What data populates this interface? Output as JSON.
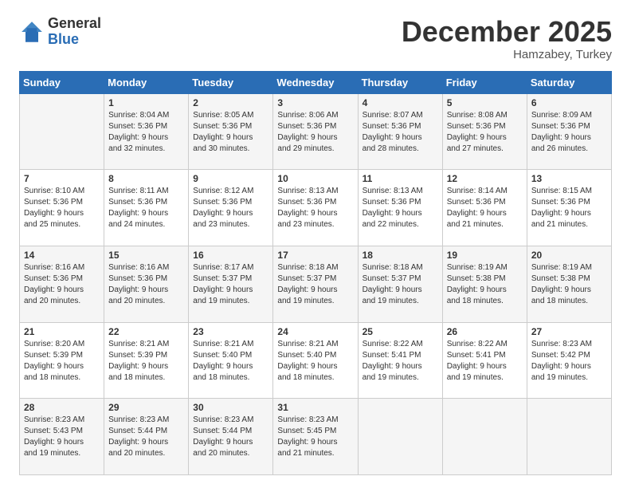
{
  "logo": {
    "general": "General",
    "blue": "Blue"
  },
  "title": "December 2025",
  "subtitle": "Hamzabey, Turkey",
  "header_days": [
    "Sunday",
    "Monday",
    "Tuesday",
    "Wednesday",
    "Thursday",
    "Friday",
    "Saturday"
  ],
  "weeks": [
    [
      {
        "day": "",
        "info": ""
      },
      {
        "day": "1",
        "info": "Sunrise: 8:04 AM\nSunset: 5:36 PM\nDaylight: 9 hours\nand 32 minutes."
      },
      {
        "day": "2",
        "info": "Sunrise: 8:05 AM\nSunset: 5:36 PM\nDaylight: 9 hours\nand 30 minutes."
      },
      {
        "day": "3",
        "info": "Sunrise: 8:06 AM\nSunset: 5:36 PM\nDaylight: 9 hours\nand 29 minutes."
      },
      {
        "day": "4",
        "info": "Sunrise: 8:07 AM\nSunset: 5:36 PM\nDaylight: 9 hours\nand 28 minutes."
      },
      {
        "day": "5",
        "info": "Sunrise: 8:08 AM\nSunset: 5:36 PM\nDaylight: 9 hours\nand 27 minutes."
      },
      {
        "day": "6",
        "info": "Sunrise: 8:09 AM\nSunset: 5:36 PM\nDaylight: 9 hours\nand 26 minutes."
      }
    ],
    [
      {
        "day": "7",
        "info": "Sunrise: 8:10 AM\nSunset: 5:36 PM\nDaylight: 9 hours\nand 25 minutes."
      },
      {
        "day": "8",
        "info": "Sunrise: 8:11 AM\nSunset: 5:36 PM\nDaylight: 9 hours\nand 24 minutes."
      },
      {
        "day": "9",
        "info": "Sunrise: 8:12 AM\nSunset: 5:36 PM\nDaylight: 9 hours\nand 23 minutes."
      },
      {
        "day": "10",
        "info": "Sunrise: 8:13 AM\nSunset: 5:36 PM\nDaylight: 9 hours\nand 23 minutes."
      },
      {
        "day": "11",
        "info": "Sunrise: 8:13 AM\nSunset: 5:36 PM\nDaylight: 9 hours\nand 22 minutes."
      },
      {
        "day": "12",
        "info": "Sunrise: 8:14 AM\nSunset: 5:36 PM\nDaylight: 9 hours\nand 21 minutes."
      },
      {
        "day": "13",
        "info": "Sunrise: 8:15 AM\nSunset: 5:36 PM\nDaylight: 9 hours\nand 21 minutes."
      }
    ],
    [
      {
        "day": "14",
        "info": "Sunrise: 8:16 AM\nSunset: 5:36 PM\nDaylight: 9 hours\nand 20 minutes."
      },
      {
        "day": "15",
        "info": "Sunrise: 8:16 AM\nSunset: 5:36 PM\nDaylight: 9 hours\nand 20 minutes."
      },
      {
        "day": "16",
        "info": "Sunrise: 8:17 AM\nSunset: 5:37 PM\nDaylight: 9 hours\nand 19 minutes."
      },
      {
        "day": "17",
        "info": "Sunrise: 8:18 AM\nSunset: 5:37 PM\nDaylight: 9 hours\nand 19 minutes."
      },
      {
        "day": "18",
        "info": "Sunrise: 8:18 AM\nSunset: 5:37 PM\nDaylight: 9 hours\nand 19 minutes."
      },
      {
        "day": "19",
        "info": "Sunrise: 8:19 AM\nSunset: 5:38 PM\nDaylight: 9 hours\nand 18 minutes."
      },
      {
        "day": "20",
        "info": "Sunrise: 8:19 AM\nSunset: 5:38 PM\nDaylight: 9 hours\nand 18 minutes."
      }
    ],
    [
      {
        "day": "21",
        "info": "Sunrise: 8:20 AM\nSunset: 5:39 PM\nDaylight: 9 hours\nand 18 minutes."
      },
      {
        "day": "22",
        "info": "Sunrise: 8:21 AM\nSunset: 5:39 PM\nDaylight: 9 hours\nand 18 minutes."
      },
      {
        "day": "23",
        "info": "Sunrise: 8:21 AM\nSunset: 5:40 PM\nDaylight: 9 hours\nand 18 minutes."
      },
      {
        "day": "24",
        "info": "Sunrise: 8:21 AM\nSunset: 5:40 PM\nDaylight: 9 hours\nand 18 minutes."
      },
      {
        "day": "25",
        "info": "Sunrise: 8:22 AM\nSunset: 5:41 PM\nDaylight: 9 hours\nand 19 minutes."
      },
      {
        "day": "26",
        "info": "Sunrise: 8:22 AM\nSunset: 5:41 PM\nDaylight: 9 hours\nand 19 minutes."
      },
      {
        "day": "27",
        "info": "Sunrise: 8:23 AM\nSunset: 5:42 PM\nDaylight: 9 hours\nand 19 minutes."
      }
    ],
    [
      {
        "day": "28",
        "info": "Sunrise: 8:23 AM\nSunset: 5:43 PM\nDaylight: 9 hours\nand 19 minutes."
      },
      {
        "day": "29",
        "info": "Sunrise: 8:23 AM\nSunset: 5:44 PM\nDaylight: 9 hours\nand 20 minutes."
      },
      {
        "day": "30",
        "info": "Sunrise: 8:23 AM\nSunset: 5:44 PM\nDaylight: 9 hours\nand 20 minutes."
      },
      {
        "day": "31",
        "info": "Sunrise: 8:23 AM\nSunset: 5:45 PM\nDaylight: 9 hours\nand 21 minutes."
      },
      {
        "day": "",
        "info": ""
      },
      {
        "day": "",
        "info": ""
      },
      {
        "day": "",
        "info": ""
      }
    ]
  ]
}
